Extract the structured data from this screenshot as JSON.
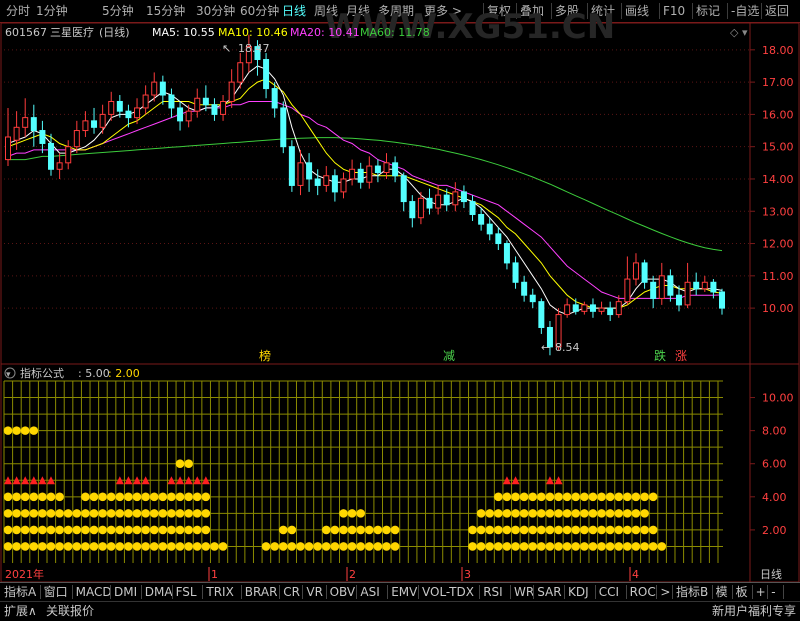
{
  "toolbar": {
    "period_buttons": [
      "分时",
      "1分钟",
      "5分钟",
      "15分钟",
      "30分钟",
      "60分钟",
      "日线",
      "周线",
      "月线",
      "多周期",
      "更多 >"
    ],
    "active_period": "日线",
    "right_buttons": [
      "复权",
      "叠加",
      "多股",
      "统计",
      "画线",
      "F10",
      "标记",
      "-自选",
      "返回"
    ]
  },
  "header": {
    "code": "601567",
    "name": "三星医疗",
    "period_label": "(日线)",
    "ma5_label": "MA5: 10.55",
    "ma10_label": "MA10: 10.46",
    "ma20_label": "MA20: 10.41",
    "ma60_label": "MA60: 11.78"
  },
  "watermark": "WWW.XG51.CN",
  "price_axis": [
    "18.00",
    "17.00",
    "16.00",
    "15.00",
    "14.00",
    "13.00",
    "12.00",
    "11.00",
    "10.00"
  ],
  "annotations": {
    "high": "18.47",
    "low": "8.54"
  },
  "signals": [
    {
      "text": "榜",
      "color": "#ffd700"
    },
    {
      "text": "减",
      "color": "#4cd34c"
    },
    {
      "text": "跌",
      "color": "#4cd34c"
    },
    {
      "text": "涨",
      "color": "#ff4040"
    }
  ],
  "indicator": {
    "title": "指标公式",
    "v1": ": 5.00",
    "v2": ": 2.00",
    "axis": [
      "10.00",
      "8.00",
      "6.00",
      "4.00",
      "2.00"
    ]
  },
  "date_axis": {
    "year": "2021年",
    "months": [
      "1",
      "2",
      "3",
      "4"
    ],
    "period_box": "日线"
  },
  "tabs": [
    "指标A",
    "窗口",
    "MACD",
    "DMI",
    "DMA",
    "FSL",
    "TRIX",
    "BRAR",
    "CR",
    "VR",
    "OBV",
    "ASI",
    "EMV",
    "VOL-TDX",
    "RSI",
    "WR",
    "SAR",
    "KDJ",
    "CCI",
    "ROC",
    ">",
    "指标B",
    "模",
    "板",
    "+",
    "-"
  ],
  "footer": {
    "left1": "扩展∧",
    "left2": "关联报价",
    "right": "新用户福利专享"
  },
  "colors": {
    "up": "#ff3c3c",
    "down": "#54ffff",
    "ma5": "#ffffff",
    "ma10": "#ffff00",
    "ma20": "#ff40ff",
    "ma60": "#3ccc3c",
    "border": "#7a1a1a",
    "grid": "#8b8b00",
    "dot": "#ffd700"
  },
  "chart_data": {
    "type": "candlestick",
    "y_range": [
      8.3,
      18.8
    ],
    "candles": [
      [
        14.6,
        15.3,
        16.2,
        14.4
      ],
      [
        15.2,
        15.6,
        16.1,
        14.9
      ],
      [
        15.6,
        15.9,
        16.5,
        15.3
      ],
      [
        15.9,
        15.5,
        16.3,
        15.0
      ],
      [
        15.5,
        15.1,
        15.8,
        14.8
      ],
      [
        15.1,
        14.3,
        15.4,
        14.1
      ],
      [
        14.3,
        14.5,
        14.8,
        14.0
      ],
      [
        14.5,
        15.0,
        15.2,
        14.3
      ],
      [
        15.0,
        15.5,
        15.8,
        14.8
      ],
      [
        15.5,
        15.8,
        16.1,
        15.3
      ],
      [
        15.8,
        15.6,
        16.2,
        15.4
      ],
      [
        15.6,
        16.0,
        16.3,
        15.4
      ],
      [
        16.0,
        16.4,
        16.7,
        15.8
      ],
      [
        16.4,
        16.1,
        16.6,
        15.9
      ],
      [
        16.1,
        15.9,
        16.3,
        15.6
      ],
      [
        15.9,
        16.2,
        16.5,
        15.7
      ],
      [
        16.2,
        16.6,
        16.9,
        16.0
      ],
      [
        16.6,
        17.0,
        17.3,
        16.4
      ],
      [
        17.0,
        16.6,
        17.2,
        16.3
      ],
      [
        16.6,
        16.2,
        16.8,
        15.9
      ],
      [
        16.2,
        15.8,
        16.4,
        15.5
      ],
      [
        15.8,
        16.1,
        16.3,
        15.6
      ],
      [
        16.1,
        16.5,
        16.8,
        15.9
      ],
      [
        16.5,
        16.3,
        16.9,
        16.1
      ],
      [
        16.3,
        16.0,
        16.5,
        15.8
      ],
      [
        16.0,
        16.4,
        16.6,
        15.8
      ],
      [
        16.4,
        17.0,
        17.4,
        16.2
      ],
      [
        17.0,
        17.6,
        17.9,
        16.8
      ],
      [
        17.6,
        18.1,
        18.47,
        17.3
      ],
      [
        18.1,
        17.7,
        18.3,
        17.2
      ],
      [
        17.7,
        16.8,
        17.9,
        16.5
      ],
      [
        16.8,
        16.2,
        17.0,
        15.9
      ],
      [
        16.2,
        15.0,
        16.4,
        14.8
      ],
      [
        15.0,
        13.8,
        15.2,
        13.6
      ],
      [
        13.8,
        14.5,
        14.9,
        13.5
      ],
      [
        14.5,
        14.0,
        14.8,
        13.6
      ],
      [
        14.0,
        13.8,
        14.3,
        13.5
      ],
      [
        13.8,
        14.1,
        14.4,
        13.6
      ],
      [
        14.1,
        13.6,
        14.3,
        13.3
      ],
      [
        13.6,
        14.0,
        14.2,
        13.4
      ],
      [
        14.0,
        14.3,
        14.6,
        13.8
      ],
      [
        14.3,
        13.9,
        14.5,
        13.7
      ],
      [
        13.9,
        14.4,
        14.7,
        13.7
      ],
      [
        14.4,
        14.2,
        14.6,
        13.9
      ],
      [
        14.2,
        14.5,
        14.8,
        14.0
      ],
      [
        14.5,
        14.1,
        14.7,
        13.9
      ],
      [
        14.1,
        13.3,
        14.2,
        13.0
      ],
      [
        13.3,
        12.8,
        13.5,
        12.5
      ],
      [
        12.8,
        13.4,
        13.6,
        12.6
      ],
      [
        13.4,
        13.1,
        13.7,
        12.9
      ],
      [
        13.1,
        13.5,
        13.8,
        12.9
      ],
      [
        13.5,
        13.2,
        13.7,
        13.0
      ],
      [
        13.2,
        13.6,
        13.9,
        13.0
      ],
      [
        13.6,
        13.3,
        13.8,
        13.1
      ],
      [
        13.3,
        12.9,
        13.5,
        12.7
      ],
      [
        12.9,
        12.6,
        13.1,
        12.4
      ],
      [
        12.6,
        12.3,
        12.8,
        12.1
      ],
      [
        12.3,
        12.0,
        12.5,
        11.8
      ],
      [
        12.0,
        11.4,
        12.1,
        11.2
      ],
      [
        11.4,
        10.8,
        11.6,
        10.6
      ],
      [
        10.8,
        10.4,
        11.0,
        10.2
      ],
      [
        10.4,
        10.2,
        10.6,
        10.0
      ],
      [
        10.2,
        9.4,
        10.3,
        9.2
      ],
      [
        9.4,
        8.8,
        9.6,
        8.54
      ],
      [
        8.8,
        9.8,
        10.0,
        8.7
      ],
      [
        9.8,
        10.1,
        10.3,
        9.7
      ],
      [
        10.1,
        9.9,
        10.3,
        9.8
      ],
      [
        9.9,
        10.1,
        10.2,
        9.8
      ],
      [
        10.1,
        9.9,
        10.3,
        9.7
      ],
      [
        9.9,
        10.0,
        10.2,
        9.8
      ],
      [
        10.0,
        9.8,
        10.2,
        9.6
      ],
      [
        9.8,
        10.2,
        10.4,
        9.7
      ],
      [
        10.2,
        10.9,
        11.6,
        10.1
      ],
      [
        10.9,
        11.4,
        11.7,
        10.7
      ],
      [
        11.4,
        10.8,
        11.5,
        10.6
      ],
      [
        10.8,
        10.3,
        11.0,
        10.0
      ],
      [
        10.3,
        11.0,
        11.4,
        10.1
      ],
      [
        11.0,
        10.4,
        11.2,
        10.2
      ],
      [
        10.4,
        10.1,
        10.7,
        9.9
      ],
      [
        10.1,
        10.8,
        11.4,
        10.0
      ],
      [
        10.8,
        10.6,
        11.1,
        10.4
      ],
      [
        10.6,
        10.8,
        11.0,
        10.5
      ],
      [
        10.8,
        10.5,
        10.9,
        10.3
      ],
      [
        10.5,
        10.0,
        10.6,
        9.8
      ]
    ],
    "ma5": [
      15.1,
      15.2,
      15.3,
      15.5,
      15.4,
      15.1,
      14.8,
      14.8,
      14.9,
      15.0,
      15.2,
      15.5,
      15.9,
      16.0,
      16.0,
      16.1,
      16.3,
      16.5,
      16.7,
      16.6,
      16.4,
      16.2,
      16.1,
      16.2,
      16.2,
      16.3,
      16.5,
      16.9,
      17.3,
      17.5,
      17.4,
      17.1,
      16.6,
      15.6,
      14.8,
      14.3,
      14.1,
      14.0,
      13.9,
      13.9,
      14.0,
      14.0,
      14.1,
      14.1,
      14.3,
      14.3,
      14.1,
      13.8,
      13.5,
      13.3,
      13.2,
      13.2,
      13.3,
      13.4,
      13.3,
      13.1,
      12.8,
      12.5,
      12.2,
      11.8,
      11.4,
      11.0,
      10.6,
      10.1,
      9.9,
      9.8,
      9.9,
      10.0,
      10.0,
      10.0,
      10.0,
      10.0,
      10.2,
      10.6,
      10.9,
      10.9,
      10.9,
      10.8,
      10.6,
      10.5,
      10.6,
      10.6,
      10.6,
      10.55
    ],
    "ma10": [
      15.0,
      15.1,
      15.2,
      15.3,
      15.4,
      15.3,
      15.1,
      15.0,
      14.9,
      14.9,
      15.0,
      15.1,
      15.3,
      15.5,
      15.7,
      15.8,
      16.0,
      16.2,
      16.4,
      16.4,
      16.4,
      16.4,
      16.3,
      16.3,
      16.3,
      16.3,
      16.4,
      16.5,
      16.8,
      17.0,
      17.1,
      16.9,
      16.7,
      16.3,
      16.0,
      15.6,
      15.2,
      14.8,
      14.5,
      14.3,
      14.2,
      14.2,
      14.2,
      14.1,
      14.1,
      14.1,
      14.1,
      14.0,
      13.9,
      13.8,
      13.7,
      13.6,
      13.5,
      13.4,
      13.3,
      13.2,
      13.0,
      12.8,
      12.5,
      12.3,
      12.0,
      11.7,
      11.4,
      11.0,
      10.7,
      10.4,
      10.2,
      10.1,
      10.0,
      10.0,
      10.0,
      10.0,
      10.1,
      10.3,
      10.5,
      10.6,
      10.7,
      10.7,
      10.6,
      10.6,
      10.6,
      10.6,
      10.5,
      10.46
    ],
    "ma20": [
      14.7,
      14.8,
      14.8,
      14.9,
      14.9,
      14.9,
      14.9,
      14.9,
      14.9,
      14.9,
      15.0,
      15.1,
      15.2,
      15.3,
      15.4,
      15.5,
      15.6,
      15.7,
      15.8,
      15.9,
      16.0,
      16.1,
      16.1,
      16.2,
      16.2,
      16.2,
      16.3,
      16.3,
      16.4,
      16.4,
      16.4,
      16.4,
      16.3,
      16.2,
      16.0,
      15.9,
      15.7,
      15.6,
      15.4,
      15.2,
      15.1,
      14.9,
      14.8,
      14.6,
      14.5,
      14.4,
      14.3,
      14.1,
      14.0,
      13.9,
      13.8,
      13.8,
      13.7,
      13.6,
      13.5,
      13.4,
      13.3,
      13.2,
      13.0,
      12.8,
      12.6,
      12.4,
      12.2,
      11.9,
      11.6,
      11.3,
      11.1,
      10.9,
      10.7,
      10.5,
      10.4,
      10.3,
      10.3,
      10.3,
      10.3,
      10.3,
      10.3,
      10.3,
      10.3,
      10.4,
      10.4,
      10.4,
      10.4,
      10.41
    ],
    "ma60": [
      14.6,
      14.6,
      14.6,
      14.65,
      14.7,
      14.7,
      14.72,
      14.74,
      14.76,
      14.78,
      14.8,
      14.82,
      14.84,
      14.86,
      14.88,
      14.9,
      14.92,
      14.94,
      14.96,
      14.98,
      15.0,
      15.02,
      15.04,
      15.06,
      15.08,
      15.1,
      15.12,
      15.14,
      15.16,
      15.18,
      15.2,
      15.22,
      15.24,
      15.25,
      15.26,
      15.27,
      15.28,
      15.28,
      15.28,
      15.27,
      15.26,
      15.24,
      15.22,
      15.2,
      15.17,
      15.14,
      15.1,
      15.06,
      15.02,
      14.97,
      14.92,
      14.86,
      14.8,
      14.74,
      14.67,
      14.6,
      14.52,
      14.44,
      14.35,
      14.26,
      14.16,
      14.06,
      13.95,
      13.84,
      13.72,
      13.6,
      13.48,
      13.36,
      13.24,
      13.12,
      13.0,
      12.88,
      12.76,
      12.64,
      12.53,
      12.42,
      12.31,
      12.21,
      12.11,
      12.02,
      11.94,
      11.87,
      11.82,
      11.78
    ],
    "indicator_levels": [
      {
        "value": 1,
        "color": "#ffd700",
        "segments": [
          [
            0,
            25
          ],
          [
            30,
            45
          ],
          [
            54,
            76
          ]
        ]
      },
      {
        "value": 2,
        "color": "#ffd700",
        "segments": [
          [
            0,
            23
          ],
          [
            32,
            33
          ],
          [
            37,
            45
          ],
          [
            54,
            75
          ]
        ]
      },
      {
        "value": 3,
        "color": "#ffd700",
        "segments": [
          [
            0,
            23
          ],
          [
            39,
            41
          ],
          [
            55,
            74
          ]
        ]
      },
      {
        "value": 4,
        "color": "#ffd700",
        "segments": [
          [
            0,
            6
          ],
          [
            9,
            23
          ],
          [
            57,
            63
          ],
          [
            64,
            75
          ]
        ]
      },
      {
        "value": 5,
        "color": "#ff2020",
        "segments": [
          [
            0,
            5
          ],
          [
            13,
            16
          ],
          [
            19,
            23
          ],
          [
            58,
            59
          ],
          [
            63,
            64
          ]
        ]
      },
      {
        "value": 6,
        "color": "#ffd700",
        "segments": [
          [
            20,
            21
          ]
        ]
      },
      {
        "value": 8,
        "color": "#ffd700",
        "segments": [
          [
            0,
            3
          ]
        ]
      }
    ]
  }
}
